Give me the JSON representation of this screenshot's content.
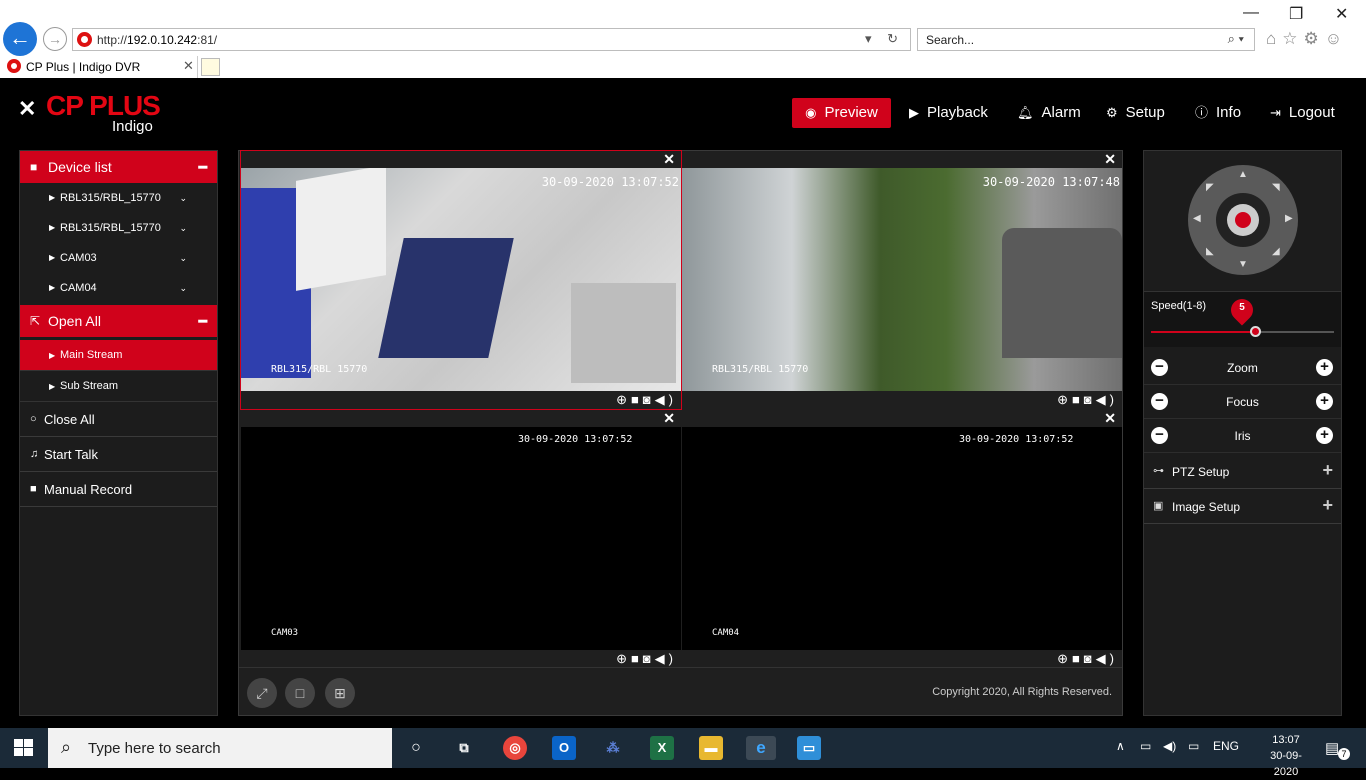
{
  "browser": {
    "url_prefix": "http://",
    "url_host": "192.0.10.242",
    "url_suffix": ":81/",
    "search_placeholder": "Search...",
    "tab_title": "CP Plus | Indigo DVR"
  },
  "brand": {
    "name": "CP PLUS",
    "sub": "Indigo",
    "accent": "#d0021b"
  },
  "nav": {
    "preview": "Preview",
    "playback": "Playback",
    "alarm": "Alarm",
    "setup": "Setup",
    "info": "Info",
    "logout": "Logout"
  },
  "sidebar": {
    "device_list": "Device list",
    "devices": [
      "RBL315/RBL_15770",
      "RBL315/RBL_15770",
      "CAM03",
      "CAM04"
    ],
    "open_all": "Open All",
    "main_stream": "Main Stream",
    "sub_stream": "Sub Stream",
    "close_all": "Close All",
    "start_talk": "Start Talk",
    "manual_record": "Manual Record"
  },
  "cameras": [
    {
      "timestamp": "30-09-2020 13:07:52",
      "name": "RBL315/RBL 15770"
    },
    {
      "timestamp": "30-09-2020 13:07:48",
      "name": "RBL315/RBL 15770"
    },
    {
      "timestamp": "30-09-2020 13:07:52",
      "name": "CAM03"
    },
    {
      "timestamp": "30-09-2020 13:07:52",
      "name": "CAM04"
    }
  ],
  "footer": {
    "copyright": "Copyright 2020, All Rights Reserved."
  },
  "ptz": {
    "speed_label": "Speed(1-8)",
    "speed_value": "5",
    "speed_fraction": 0.57,
    "zoom": "Zoom",
    "focus": "Focus",
    "iris": "Iris",
    "ptz_setup": "PTZ Setup",
    "image_setup": "Image Setup"
  },
  "taskbar": {
    "search": "Type here to search",
    "lang": "ENG",
    "time": "13:07",
    "date": "30-09-2020",
    "notifications": "7"
  }
}
